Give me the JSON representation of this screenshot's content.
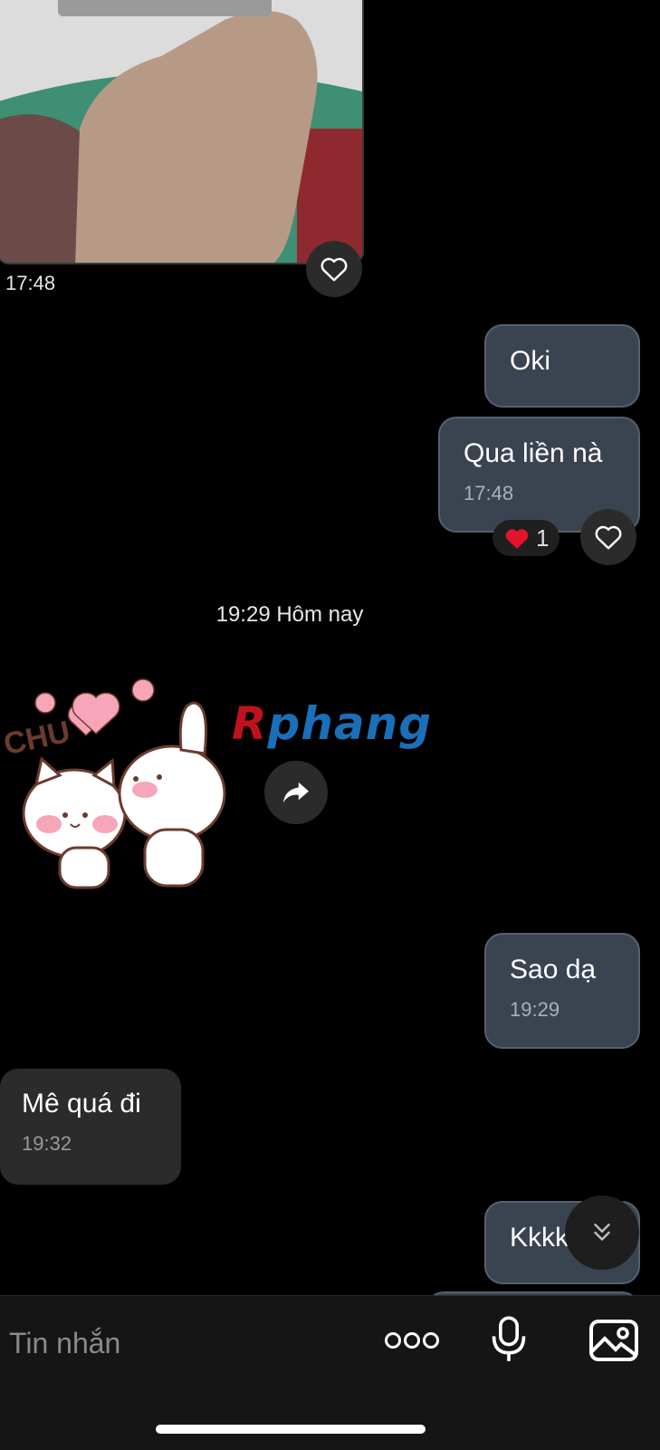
{
  "messages": {
    "photo_time": "17:48",
    "out1_text": "Oki",
    "out2_text": "Qua liền nà",
    "out2_time": "17:48",
    "out2_reaction_count": "1",
    "date_separator": "19:29 Hôm nay",
    "sticker_text": "CHU",
    "watermark": "Rphang",
    "out3_text": "Sao dạ",
    "out3_time": "19:29",
    "in1_text": "Mê quá đi",
    "in1_time": "19:32",
    "out4_text_partial": "Kkkk"
  },
  "input": {
    "placeholder": "Tin nhắn"
  },
  "icons": {
    "heart": "heart-outline-icon",
    "reaction": "red-heart-emoji",
    "forward": "forward-arrow-icon",
    "scroll_down": "double-chevron-down-icon",
    "more": "more-dots-icon",
    "mic": "microphone-icon",
    "image": "image-gallery-icon"
  },
  "colors": {
    "background": "#000000",
    "outgoing_bubble": "#3a4350",
    "incoming_bubble": "#2b2b2b",
    "input_bar": "#151515"
  }
}
